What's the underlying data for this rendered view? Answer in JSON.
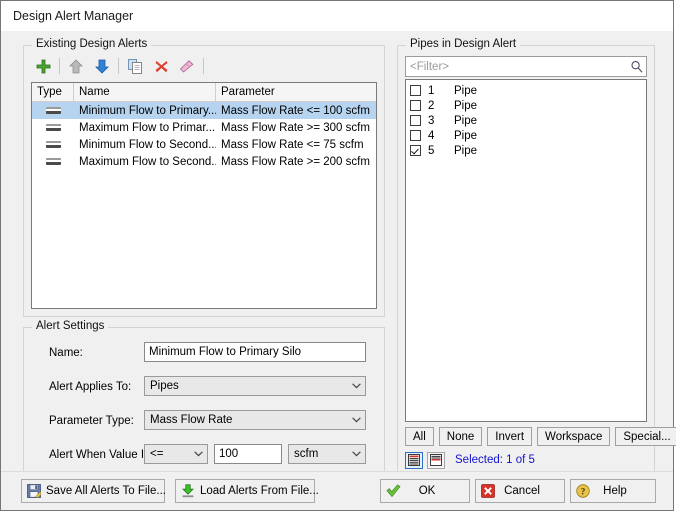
{
  "window": {
    "title": "Design Alert Manager"
  },
  "left_panel": {
    "legend": "Existing Design Alerts",
    "toolbar": [
      {
        "name": "add-alert-button",
        "icon": "plus-icon",
        "tooltip": "Add"
      },
      {
        "name": "move-up-button",
        "icon": "arrow-up-icon",
        "tooltip": "Move Up"
      },
      {
        "name": "move-down-button",
        "icon": "arrow-down-icon",
        "tooltip": "Move Down"
      },
      {
        "name": "duplicate-alert-button",
        "icon": "copy-icon",
        "tooltip": "Duplicate"
      },
      {
        "name": "delete-alert-button",
        "icon": "delete-x-icon",
        "tooltip": "Delete"
      },
      {
        "name": "clear-alerts-button",
        "icon": "eraser-icon",
        "tooltip": "Clear"
      }
    ],
    "columns": [
      "Type",
      "Name",
      "Parameter"
    ],
    "rows": [
      {
        "type_icon": "pipe-icon",
        "name": "Minimum Flow to Primary...",
        "parameter": "Mass Flow Rate <= 100 scfm",
        "selected": true
      },
      {
        "type_icon": "pipe-icon",
        "name": "Maximum Flow to Primar...",
        "parameter": "Mass Flow Rate >= 300 scfm",
        "selected": false
      },
      {
        "type_icon": "pipe-icon",
        "name": "Minimum Flow to Second...",
        "parameter": "Mass Flow Rate <= 75 scfm",
        "selected": false
      },
      {
        "type_icon": "pipe-icon",
        "name": "Maximum Flow to Second...",
        "parameter": "Mass Flow Rate >= 200 scfm",
        "selected": false
      }
    ]
  },
  "right_panel": {
    "legend": "Pipes in Design Alert",
    "filter": {
      "value": "",
      "placeholder": "<Filter>"
    },
    "pipes": [
      {
        "number": "1",
        "label": "Pipe",
        "checked": false
      },
      {
        "number": "2",
        "label": "Pipe",
        "checked": false
      },
      {
        "number": "3",
        "label": "Pipe",
        "checked": false
      },
      {
        "number": "4",
        "label": "Pipe",
        "checked": false
      },
      {
        "number": "5",
        "label": "Pipe",
        "checked": true
      }
    ],
    "select_buttons": [
      {
        "name": "select-all-button",
        "label": "All"
      },
      {
        "name": "select-none-button",
        "label": "None"
      },
      {
        "name": "select-invert-button",
        "label": "Invert"
      },
      {
        "name": "select-workspace-button",
        "label": "Workspace"
      },
      {
        "name": "select-special-button",
        "label": "Special..."
      }
    ],
    "view_toggles": [
      {
        "name": "list-view-toggle",
        "active": true
      },
      {
        "name": "grouped-view-toggle",
        "active": false
      }
    ],
    "selected_status": "Selected: 1 of 5",
    "selected_status_color": "#1414cf"
  },
  "alert_settings": {
    "legend": "Alert Settings",
    "name": {
      "label": "Name:",
      "value": "Minimum Flow to Primary Silo"
    },
    "applies_to": {
      "label": "Alert Applies To:",
      "value": "Pipes"
    },
    "parameter_type": {
      "label": "Parameter Type:",
      "value": "Mass Flow Rate"
    },
    "alert_when": {
      "label": "Alert When Value Is:",
      "operator": "<=",
      "value": "100",
      "units": "scfm"
    }
  },
  "bottom_bar": {
    "save_button": {
      "label": "Save All Alerts To File...",
      "icon": "save-disk-icon"
    },
    "load_button": {
      "label": "Load Alerts From File...",
      "icon": "download-icon"
    },
    "ok_button": {
      "label": "OK",
      "icon": "green-check-icon"
    },
    "cancel_button": {
      "label": "Cancel",
      "icon": "red-x-icon"
    },
    "help_button": {
      "label": "Help",
      "icon": "question-mark-icon"
    }
  }
}
